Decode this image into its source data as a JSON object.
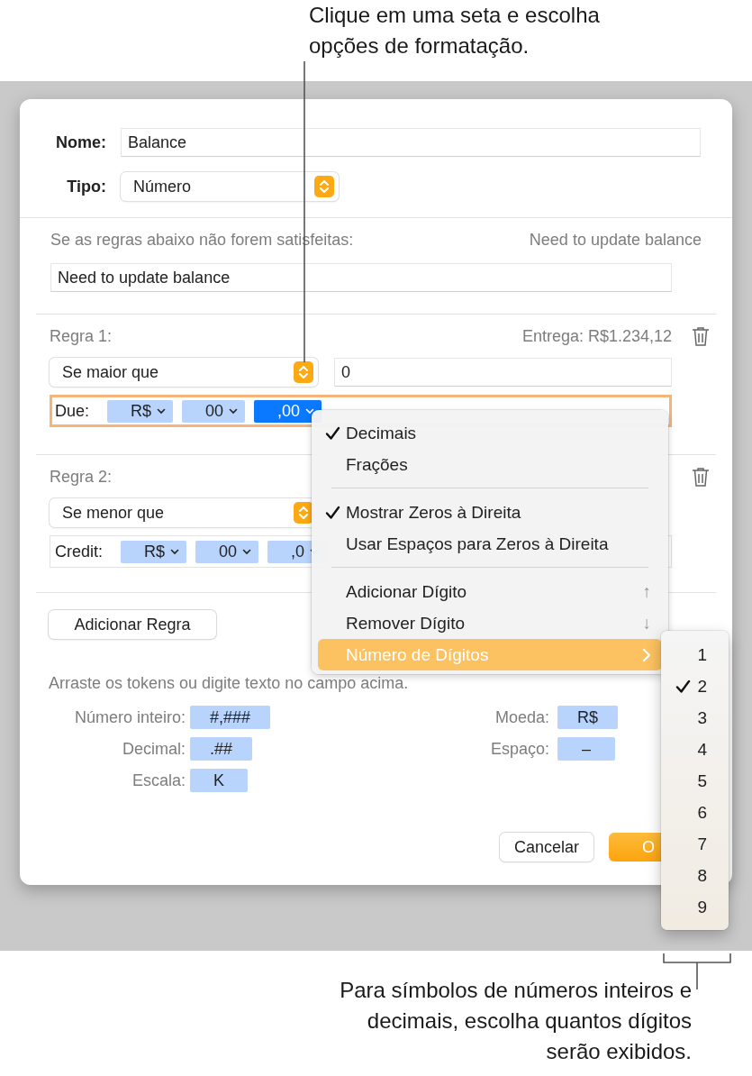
{
  "callouts": [
    {
      "text": "Clique em uma seta e escolha opções de formatação."
    },
    {
      "text": "Para símbolos de números inteiros e decimais, escolha quantos dígitos serão exibidos."
    }
  ],
  "dialog": {
    "name_label": "Nome:",
    "name_value": "Balance",
    "type_label": "Tipo:",
    "type_value": "Número",
    "unmet_label": "Se as regras abaixo não forem satisfeitas:",
    "unmet_preview": "Need to update balance",
    "unmet_value": "Need to update balance",
    "rules": [
      {
        "label": "Regra 1:",
        "preview": "Entrega: R$1.234,12",
        "condition": "Se maior que",
        "value": "0",
        "prefix": "Due:",
        "focused": true,
        "tokens": [
          {
            "text": "R$",
            "selected": false
          },
          {
            "text": "00",
            "selected": false
          },
          {
            "text": ",00",
            "selected": true
          }
        ]
      },
      {
        "label": "Regra 2:",
        "condition": "Se menor que",
        "prefix": "Credit:",
        "focused": false,
        "tokens": [
          {
            "text": "R$",
            "selected": false
          },
          {
            "text": "00",
            "selected": false
          },
          {
            "text": ",0",
            "selected": false
          }
        ]
      }
    ],
    "add_rule": "Adicionar Regra",
    "hint": "Arraste os tokens ou digite texto no campo acima.",
    "token_columns": [
      [
        {
          "label": "Número inteiro:",
          "token": "#,###"
        },
        {
          "label": "Decimal:",
          "token": ".##"
        },
        {
          "label": "Escala:",
          "token": "K"
        }
      ],
      [
        {
          "label": "Moeda:",
          "token": "R$"
        },
        {
          "label": "Espaço:",
          "token": "–"
        }
      ]
    ],
    "buttons": [
      {
        "label": "Cancelar",
        "kind": "secondary"
      },
      {
        "label": "O",
        "kind": "primary"
      }
    ]
  },
  "menu": {
    "items": [
      {
        "kind": "item",
        "label": "Decimais",
        "checked": true,
        "selected": false
      },
      {
        "kind": "item",
        "label": "Frações",
        "checked": false,
        "selected": false
      },
      {
        "kind": "separator"
      },
      {
        "kind": "item",
        "label": "Mostrar Zeros à Direita",
        "checked": true,
        "selected": false
      },
      {
        "kind": "item",
        "label": "Usar Espaços para Zeros à Direita",
        "checked": false,
        "selected": false
      },
      {
        "kind": "separator"
      },
      {
        "kind": "item",
        "label": "Adicionar Dígito",
        "shortcut": "↑",
        "checked": false,
        "selected": false
      },
      {
        "kind": "item",
        "label": "Remover Dígito",
        "shortcut": "↓",
        "checked": false,
        "selected": false
      },
      {
        "kind": "submenu",
        "label": "Número de Dígitos",
        "checked": false,
        "selected": true
      }
    ]
  },
  "submenu": {
    "items": [
      {
        "label": "1",
        "checked": false
      },
      {
        "label": "2",
        "checked": true
      },
      {
        "label": "3",
        "checked": false
      },
      {
        "label": "4",
        "checked": false
      },
      {
        "label": "5",
        "checked": false
      },
      {
        "label": "6",
        "checked": false
      },
      {
        "label": "7",
        "checked": false
      },
      {
        "label": "8",
        "checked": false
      },
      {
        "label": "9",
        "checked": false
      }
    ]
  }
}
